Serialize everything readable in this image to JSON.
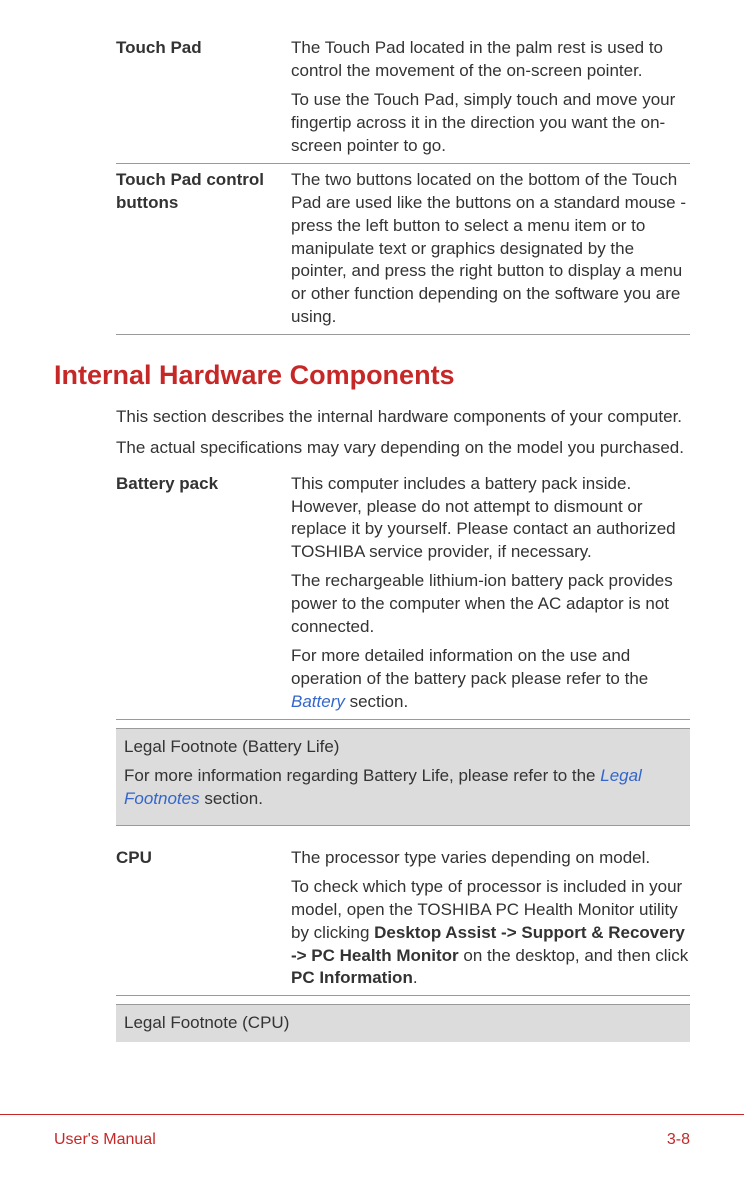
{
  "table1": {
    "row1": {
      "term": "Touch Pad",
      "p1": "The Touch Pad located in the palm rest is used to control the movement of the on-screen pointer.",
      "p2": "To use the Touch Pad, simply touch and move your fingertip across it in the direction you want the on-screen pointer to go."
    },
    "row2": {
      "term": "Touch Pad control buttons",
      "p1": "The two buttons located on the bottom of the Touch Pad are used like the buttons on a standard mouse - press the left button to select a menu item or to manipulate text or graphics designated by the pointer, and press the right button to display a menu or other function depending on the software you are using."
    }
  },
  "heading": "Internal Hardware Components",
  "intro": {
    "p1": "This section describes the internal hardware components of your computer.",
    "p2": "The actual specifications may vary depending on the model you purchased."
  },
  "table2": {
    "row1": {
      "term": "Battery pack",
      "p1": "This computer includes a battery pack inside. However, please do not attempt to dismount or replace it by yourself. Please contact an authorized TOSHIBA service provider, if necessary.",
      "p2": "The rechargeable lithium-ion battery pack provides power to the computer when the AC adaptor is not connected.",
      "p3a": "For more detailed information on the use and operation of the battery pack please refer to the ",
      "p3link": "Battery",
      "p3b": " section."
    }
  },
  "legal1": {
    "title": "Legal Footnote (Battery Life)",
    "textA": "For more information regarding Battery Life, please refer to the ",
    "link": "Legal Footnotes",
    "textB": " section."
  },
  "table3": {
    "row1": {
      "term": "CPU",
      "p1": "The processor type varies depending on model.",
      "p2a": "To check which type of processor is included in your model, open the TOSHIBA PC Health Monitor utility by clicking ",
      "p2bold1": "Desktop Assist -> Support & Recovery -> PC Health Monitor",
      "p2b": " on the desktop, and then click ",
      "p2bold2": "PC Information",
      "p2c": "."
    }
  },
  "legal2": {
    "title": "Legal Footnote (CPU)"
  },
  "footer": {
    "left": "User's Manual",
    "right": "3-8"
  }
}
